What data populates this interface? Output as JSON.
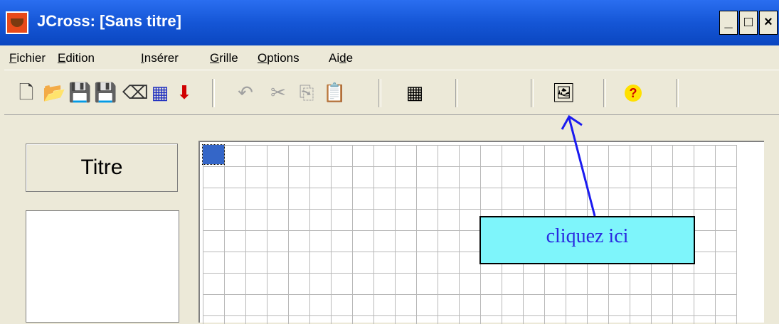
{
  "window": {
    "title": "JCross: [Sans titre]",
    "controls": [
      "_",
      "□",
      "×"
    ]
  },
  "menu": {
    "items": [
      {
        "first": "F",
        "rest": "ichier"
      },
      {
        "first": "E",
        "rest": "dition"
      },
      {
        "first": "I",
        "rest": "nsérer"
      },
      {
        "first": "G",
        "rest": "rille"
      },
      {
        "first": "O",
        "rest": "ptions"
      },
      {
        "first": "Ai",
        "ul": "d",
        "rest": "e"
      }
    ]
  },
  "toolbar": {
    "buttons": [
      {
        "name": "new-file-icon",
        "glyph": "🗋"
      },
      {
        "name": "open-folder-icon",
        "glyph": "📂"
      },
      {
        "name": "save-icon",
        "glyph": "💾"
      },
      {
        "name": "save-as-icon",
        "glyph": "💾"
      },
      {
        "name": "eraser-icon",
        "glyph": "⌫"
      },
      {
        "name": "web-export-icon",
        "glyph": "▦"
      },
      {
        "name": "down-arrow-icon",
        "glyph": "⬇"
      },
      {
        "name": "undo-icon",
        "glyph": "↶"
      },
      {
        "name": "cut-icon",
        "glyph": "✂"
      },
      {
        "name": "copy-icon",
        "glyph": "⎘"
      },
      {
        "name": "paste-icon",
        "glyph": "📋"
      },
      {
        "name": "grid-icon",
        "glyph": "▦"
      },
      {
        "name": "config-icon",
        "glyph": "🖼"
      },
      {
        "name": "help-icon",
        "glyph": "?"
      }
    ]
  },
  "left_panel": {
    "title_button": "Titre"
  },
  "annotation": {
    "text": "cliquez ici"
  },
  "colors": {
    "titlebar": "#1556d6",
    "selected_cell": "#3466c8",
    "callout_bg": "#7ef5fb",
    "callout_text": "#2a2ae0",
    "arrow": "#1a1af0"
  }
}
